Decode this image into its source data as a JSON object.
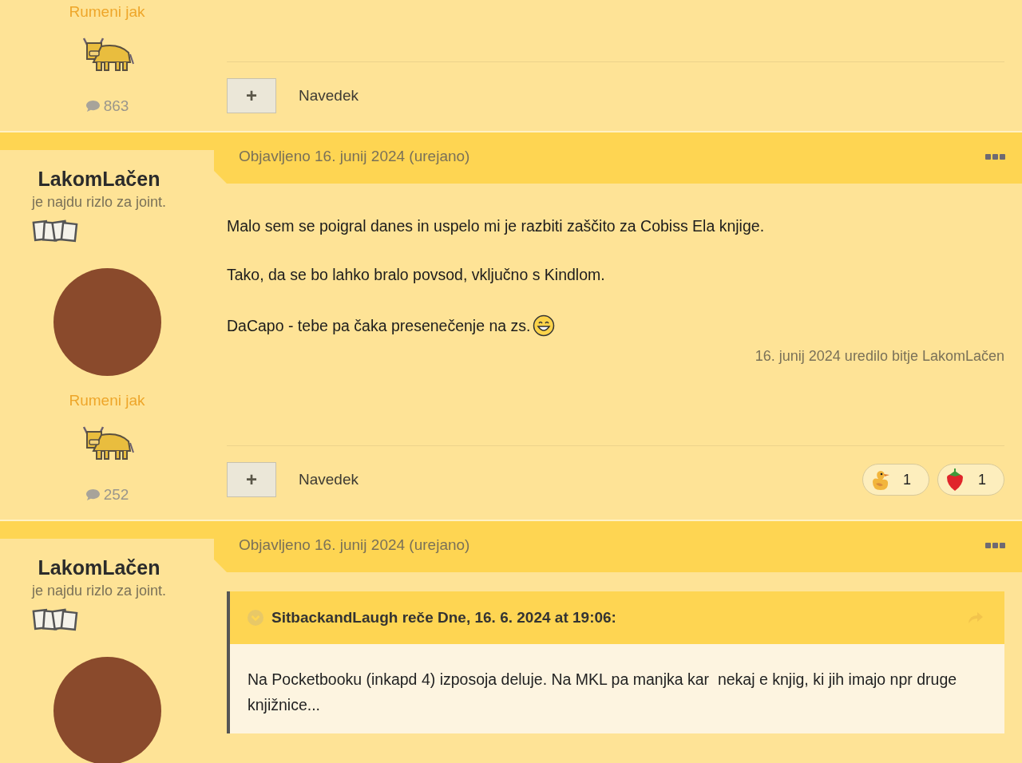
{
  "posts": [
    {
      "kind": "continued",
      "author": {
        "rank": "Rumeni jak",
        "post_count": "863"
      },
      "quote_button": {
        "icon": "+",
        "label": "Navedek"
      }
    },
    {
      "kind": "full",
      "header": "Objavljeno 16. junij 2024 (urejano)",
      "author": {
        "name": "LakomLačen",
        "title": "je najdu rizlo za joint.",
        "rank": "Rumeni jak",
        "post_count": "252"
      },
      "body": [
        {
          "kind": "paragraph",
          "text": "Malo sem se poigral danes in uspelo mi je razbiti zaščito za Cobiss Ela knjige."
        },
        {
          "kind": "paragraph",
          "text": "Tako, da se bo lahko bralo povsod, vključno s Kindlom."
        },
        {
          "kind": "paragraph",
          "text": "DaCapo - tebe pa čaka presenečenje na zs.",
          "emoji": true
        }
      ],
      "edit_note": "16. junij 2024 uredilo bitje LakomLačen",
      "quote_button": {
        "icon": "+",
        "label": "Navedek"
      },
      "reactions": [
        {
          "kind": "duck",
          "count": "1"
        },
        {
          "kind": "strawberry",
          "count": "1"
        }
      ]
    },
    {
      "kind": "full",
      "header": "Objavljeno 16. junij 2024 (urejano)",
      "author": {
        "name": "LakomLačen",
        "title": "je najdu rizlo za joint."
      },
      "body": [
        {
          "kind": "quote",
          "citation": "SitbackandLaugh reče Dne, 16. 6. 2024 at 19:06:",
          "text": "Na Pocketbooku (inkapd 4) izposoja deluje. Na MKL pa manjka kar  nekaj e knjig, ki jih imajo npr druge knjižnice..."
        }
      ]
    }
  ]
}
